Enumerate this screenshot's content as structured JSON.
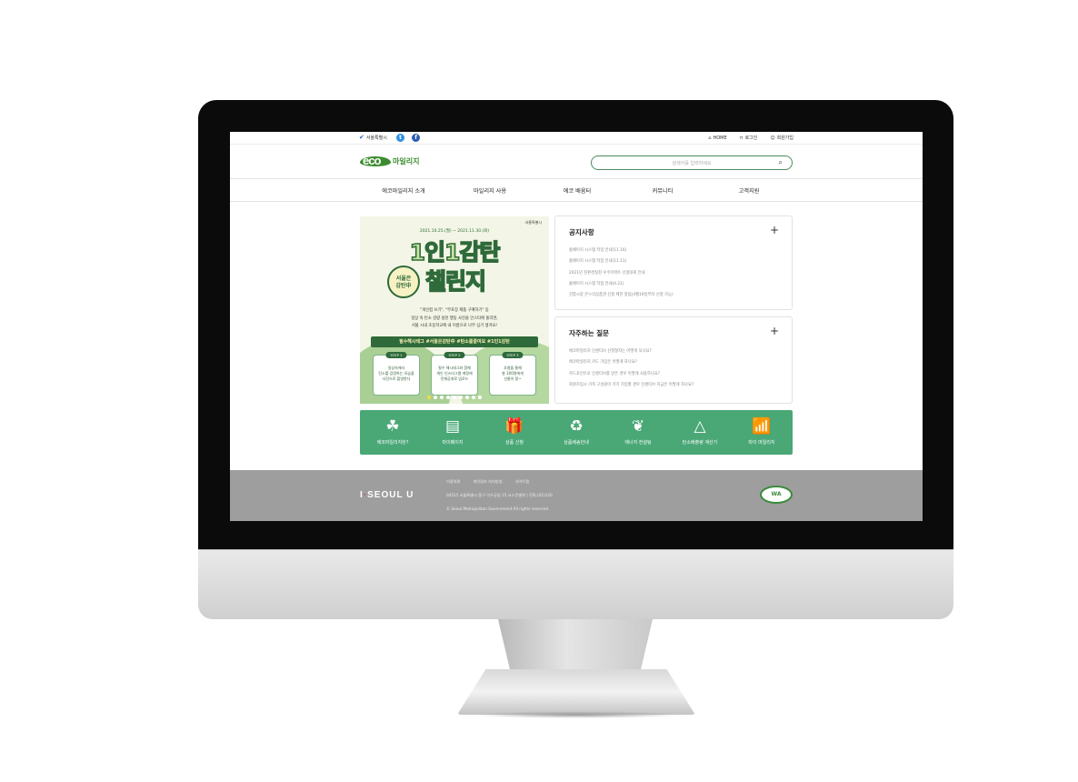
{
  "topbar": {
    "seoul_logo": "서울특별시",
    "twitter_icon": "t",
    "facebook_icon": "f",
    "home": "HOME",
    "login": "로그인",
    "join": "회원가입"
  },
  "header": {
    "logo_eco": "eco",
    "logo_mileage": "마일리지",
    "search_placeholder": "검색어를 입력하세요",
    "search_icon_glyph": "⌕"
  },
  "nav": [
    "에코마일리지 소개",
    "마일리지 사용",
    "에코 배움터",
    "커뮤니티",
    "고객지원"
  ],
  "banner": {
    "seoul": "서울특별시",
    "date": "2021.10.25.(월) ~ 2021.11.30.(화)",
    "title1": "1인1감탄",
    "badge": "서울은\n감탄中",
    "title2": "챌린지",
    "desc": [
      "\"개인컵 쓰기\", \"무포장 제품 구매하기\" 등",
      "일상 속 탄소 감량 실천 행동 사진을 인스타에 올리면,",
      "서울 시내 초등학교에 내 이름으로 나무 심기 생겨요!"
    ],
    "hashtags": "필수해시태그 #서울은감탄中 #탄소를줄여요 #1인1감탄",
    "steps": [
      {
        "tag": "STEP 1",
        "text": "일상속에서\n탄소를 감량하는 모습을\n사진으로 촬영한다"
      },
      {
        "tag": "STEP 2",
        "text": "필수 해시태그와 함께\n개인 인스타그램 계정에\n전체공개로 업로드"
      },
      {
        "tag": "STEP 3",
        "text": "추첨을 통해\n총 100명에게\n선물이 팡~"
      }
    ]
  },
  "notice": {
    "title": "공지사항",
    "plus": "+",
    "items": [
      "홈페이지 시스템 작업 안내(11.16)",
      "홈페이지 시스템 작업 안내(11.11)",
      "2021년 친환경실천 우수아파트 선정대회 안내",
      "홈페이지 시스템 작업 안내(4.21)",
      "전통시장 온누리상품권 신청 제한 알림(4월19일부터 신청 가능)"
    ]
  },
  "faq": {
    "title": "자주하는 질문",
    "plus": "+",
    "items": [
      "에코마일리지 인센티브 신청절차는 어떻게 되나요?",
      "에코마일리지 카드 가입은 어떻게 하나요?",
      "카드포인트로 인센티브를 받은 경우 어떻게 사용하나요?",
      "회원가입시 가족 구성원이 각각 가입할 경우 인센티브 지급은 어떻게 하나요?"
    ]
  },
  "quick_menu": [
    {
      "icon": "☘",
      "label": "에코마일리지란?"
    },
    {
      "icon": "▤",
      "label": "마이페이지"
    },
    {
      "icon": "🎁",
      "label": "상품 신청"
    },
    {
      "icon": "♻",
      "label": "상품배송안내"
    },
    {
      "icon": "❦",
      "label": "에너지 컨설팅"
    },
    {
      "icon": "△",
      "label": "탄소배출량 계산기"
    },
    {
      "icon": "📶",
      "label": "마이 마일리지"
    }
  ],
  "footer": {
    "logo_i": "I",
    "logo_dot": "·",
    "logo_text": "SEOUL U",
    "links": [
      "이용약관",
      "개인정보 처리방침",
      "사이트맵"
    ],
    "address": "04515 서울특별시 중구 덕수궁길 15 서소문별관 | 전화:(02)120",
    "copyright": "© Seoul Metropolitan Government All rights reserved.",
    "wa_mark": "WA"
  }
}
